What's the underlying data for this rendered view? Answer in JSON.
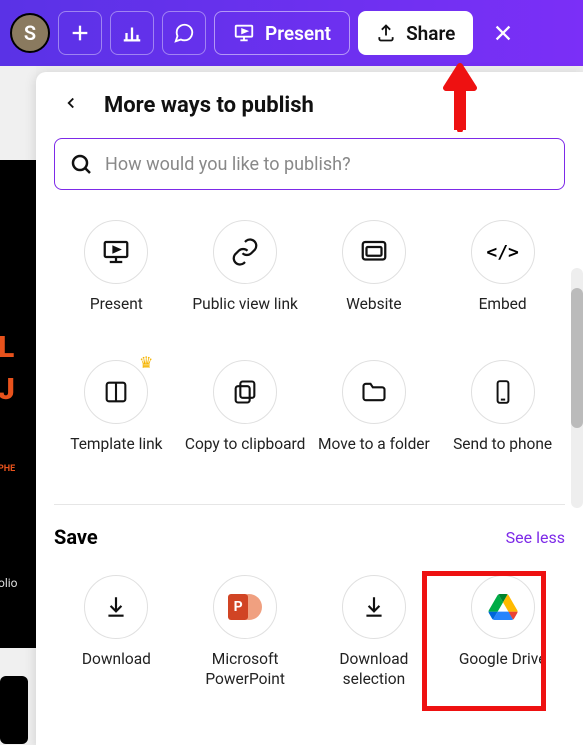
{
  "topbar": {
    "avatar_letter": "S",
    "present_label": "Present",
    "share_label": "Share"
  },
  "panel": {
    "title": "More ways to publish",
    "search_placeholder": "How would you like to publish?"
  },
  "publish_options": [
    {
      "id": "present",
      "label": "Present",
      "icon": "present-screen-icon"
    },
    {
      "id": "public-link",
      "label": "Public view link",
      "icon": "link-icon"
    },
    {
      "id": "website",
      "label": "Website",
      "icon": "website-icon"
    },
    {
      "id": "embed",
      "label": "Embed",
      "icon": "embed-icon"
    },
    {
      "id": "template-link",
      "label": "Template link",
      "icon": "template-icon",
      "premium": true
    },
    {
      "id": "copy-clipboard",
      "label": "Copy to clipboard",
      "icon": "clipboard-icon"
    },
    {
      "id": "move-folder",
      "label": "Move to a folder",
      "icon": "folder-icon"
    },
    {
      "id": "send-phone",
      "label": "Send to phone",
      "icon": "phone-icon"
    }
  ],
  "save_section": {
    "title": "Save",
    "see_less_label": "See less",
    "options": [
      {
        "id": "download",
        "label": "Download",
        "icon": "download-icon"
      },
      {
        "id": "powerpoint",
        "label": "Microsoft PowerPoint",
        "icon": "powerpoint-icon"
      },
      {
        "id": "download-selection",
        "label": "Download selection",
        "icon": "download-icon"
      },
      {
        "id": "google-drive",
        "label": "Google Drive",
        "icon": "google-drive-icon"
      }
    ]
  },
  "bg_slide": {
    "line1": "L",
    "line2": "J",
    "small": "PHE",
    "tiny": "olio"
  }
}
